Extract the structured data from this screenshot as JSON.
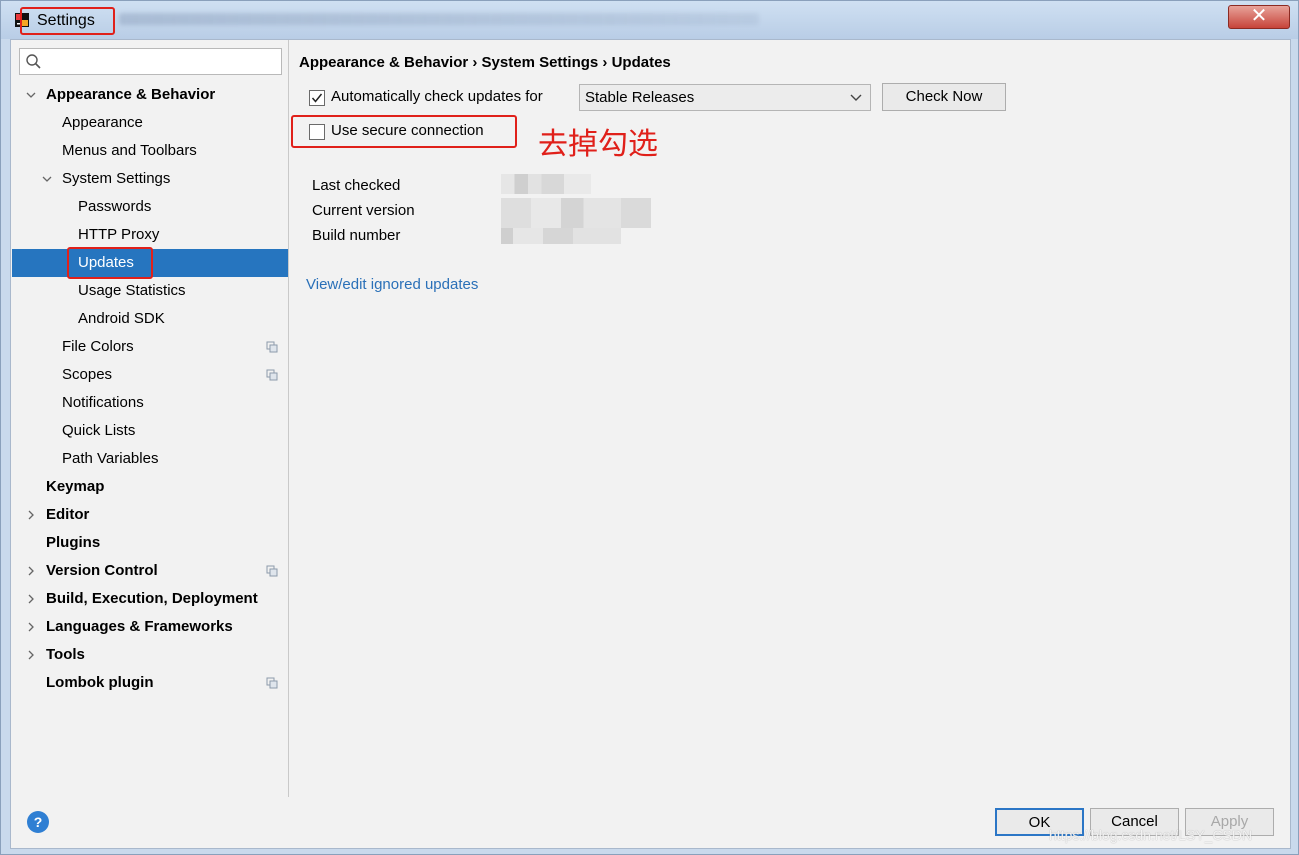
{
  "window": {
    "title": "Settings",
    "close_label": "✕"
  },
  "search": {
    "placeholder": ""
  },
  "sidebar": {
    "items": [
      {
        "label": "Appearance & Behavior",
        "bold": true,
        "expanded": true,
        "level": 0
      },
      {
        "label": "Appearance",
        "level": 1
      },
      {
        "label": "Menus and Toolbars",
        "level": 1
      },
      {
        "label": "System Settings",
        "level": 1,
        "expanded": true
      },
      {
        "label": "Passwords",
        "level": 2
      },
      {
        "label": "HTTP Proxy",
        "level": 2
      },
      {
        "label": "Updates",
        "level": 2,
        "selected": true
      },
      {
        "label": "Usage Statistics",
        "level": 2
      },
      {
        "label": "Android SDK",
        "level": 2
      },
      {
        "label": "File Colors",
        "level": 1,
        "project_icon": true
      },
      {
        "label": "Scopes",
        "level": 1,
        "project_icon": true
      },
      {
        "label": "Notifications",
        "level": 1
      },
      {
        "label": "Quick Lists",
        "level": 1
      },
      {
        "label": "Path Variables",
        "level": 1
      },
      {
        "label": "Keymap",
        "bold": true,
        "level": 0
      },
      {
        "label": "Editor",
        "bold": true,
        "level": 0,
        "collapsed": true
      },
      {
        "label": "Plugins",
        "bold": true,
        "level": 0
      },
      {
        "label": "Version Control",
        "bold": true,
        "level": 0,
        "collapsed": true,
        "project_icon": true
      },
      {
        "label": "Build, Execution, Deployment",
        "bold": true,
        "level": 0,
        "collapsed": true
      },
      {
        "label": "Languages & Frameworks",
        "bold": true,
        "level": 0,
        "collapsed": true
      },
      {
        "label": "Tools",
        "bold": true,
        "level": 0,
        "collapsed": true
      },
      {
        "label": "Lombok plugin",
        "bold": true,
        "level": 0,
        "project_icon": true
      }
    ]
  },
  "main": {
    "breadcrumb": "Appearance & Behavior › System Settings › Updates",
    "auto_check_label": "Automatically check updates for",
    "auto_check_checked": true,
    "channel_value": "Stable Releases",
    "check_now_label": "Check Now",
    "secure_label": "Use secure connection",
    "secure_checked": false,
    "annotation": "去掉勾选",
    "info": {
      "last_checked_label": "Last checked",
      "current_version_label": "Current version",
      "build_number_label": "Build number"
    },
    "ignored_link": "View/edit ignored updates"
  },
  "footer": {
    "help_label": "?",
    "ok_label": "OK",
    "cancel_label": "Cancel",
    "apply_label": "Apply"
  },
  "watermark": "https://blog.csdn.net/LSY_CSDN",
  "colors": {
    "selection": "#2675bf",
    "annotation_red": "#e0201a",
    "link": "#2a70b8"
  }
}
